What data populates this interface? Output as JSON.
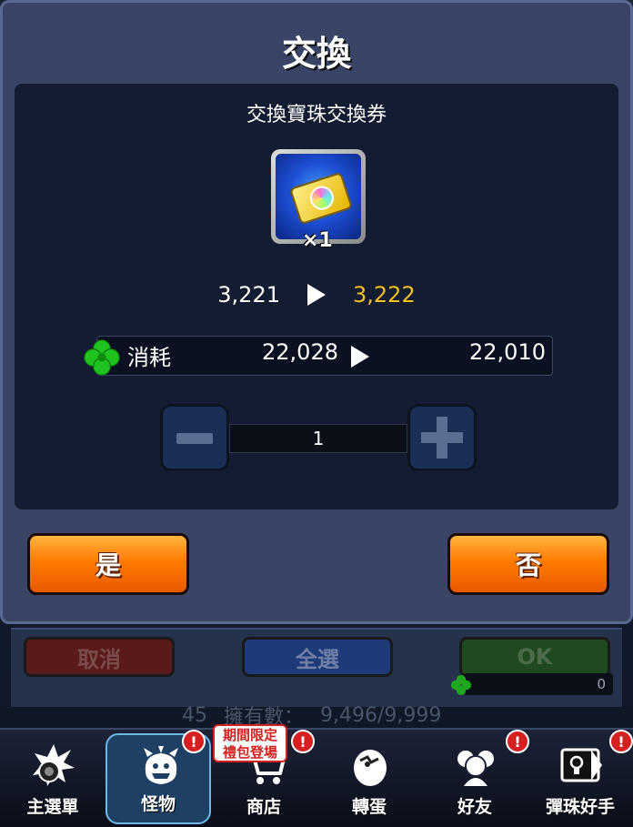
{
  "dialog": {
    "title": "交換",
    "item_name": "交換寶珠交換券",
    "item_quantity": "×1",
    "count_before": "3,221",
    "count_after": "3,222",
    "cost_label": "消耗",
    "cost_before": "22,028",
    "cost_after": "22,010",
    "stepper_value": "1",
    "yes_label": "是",
    "no_label": "否"
  },
  "background": {
    "cancel_label": "取消",
    "select_all_label": "全選",
    "ok_label": "OK",
    "clover_count": "0",
    "owned_level": "45",
    "owned_label": "擁有數：",
    "owned_count": "9,496/9,999"
  },
  "nav": {
    "items": [
      {
        "label": "主選單",
        "icon": "main-menu-icon"
      },
      {
        "label": "怪物",
        "icon": "monster-icon"
      },
      {
        "label": "商店",
        "icon": "shop-cart-icon"
      },
      {
        "label": "轉蛋",
        "icon": "gacha-egg-icon"
      },
      {
        "label": "好友",
        "icon": "friends-icon"
      },
      {
        "label": "彈珠好手",
        "icon": "striker-card-icon"
      }
    ],
    "promo_badge": "期間限定\n禮包登場",
    "alert_mark": "!"
  },
  "colors": {
    "accent_yellow": "#f0c020",
    "button_orange": "#ff7a00",
    "alert_red": "#d42020",
    "clover_green": "#1fc21f"
  }
}
